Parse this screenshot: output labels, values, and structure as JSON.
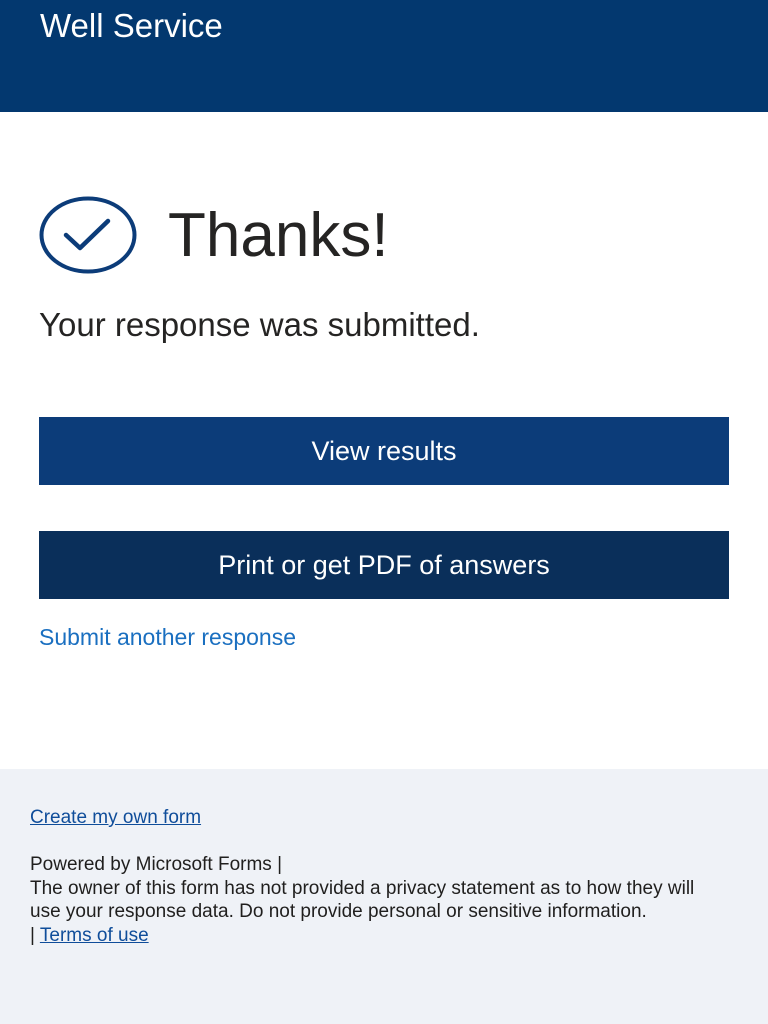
{
  "header": {
    "title": "Well Service",
    "background_color": "#03386f"
  },
  "confirmation": {
    "icon": "check-circle-icon",
    "heading": "Thanks!",
    "message": "Your response was submitted."
  },
  "actions": {
    "view_results_label": "View results",
    "print_label": "Print or get PDF of answers",
    "submit_another_label": "Submit another response"
  },
  "footer": {
    "create_form_label": "Create my own form",
    "powered_by": "Powered by Microsoft Forms |",
    "privacy_notice": "The owner of this form has not provided a privacy statement as to how they will use your response data. Do not provide personal or sensitive information.",
    "separator": "|",
    "terms_label": "Terms of use"
  },
  "colors": {
    "accent": "#0c3c79",
    "link": "#1a6fc0",
    "footer_background": "#eff2f7"
  }
}
